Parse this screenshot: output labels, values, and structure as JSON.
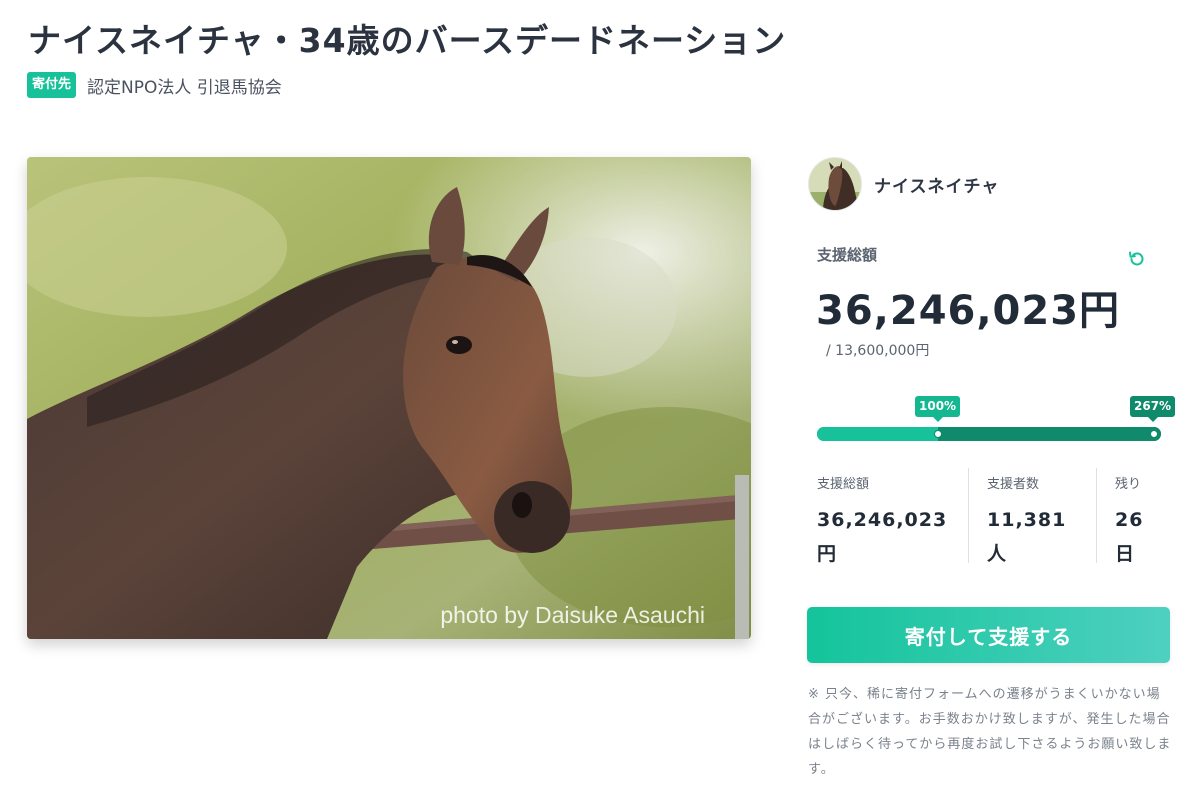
{
  "project": {
    "title": "ナイスネイチャ・34歳のバースデードネーション",
    "badge": "寄付先",
    "organization": "認定NPO法人 引退馬協会",
    "photo_credit": "photo by Daisuke Asauchi"
  },
  "owner": {
    "name": "ナイスネイチャ"
  },
  "funding": {
    "total_label": "支援総額",
    "total_amount": "36,246,023円",
    "goal": "/ 13,600,000円",
    "progress_percent": 267,
    "milestone_label": "100%",
    "current_label": "267%"
  },
  "stats": [
    {
      "label": "支援総額",
      "value": "36,246,023円"
    },
    {
      "label": "支援者数",
      "value": "11,381人"
    },
    {
      "label": "残り",
      "value": "26日"
    }
  ],
  "cta": {
    "label": "寄付して支援する"
  },
  "note": "※ 只今、稀に寄付フォームへの遷移がうまくいかない場合がございます。お手数おかけ致しますが、発生した場合はしばらく待ってから再度お試し下さるようお願い致します。",
  "colors": {
    "accent": "#17c29a",
    "accent_dark": "#0f8a6b",
    "text": "#222b38"
  }
}
